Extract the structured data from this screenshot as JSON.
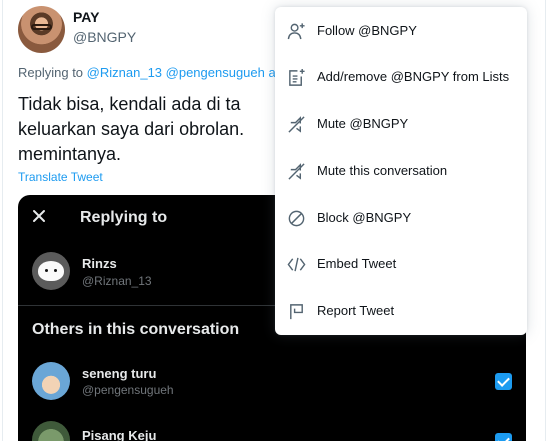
{
  "tweet": {
    "author_name": "PAY",
    "author_handle": "@BNGPY",
    "replying_prefix": "Replying to",
    "replying_mentions": "@Riznan_13 @pengensugueh ar",
    "text_line1": "Tidak bisa, kendali ada di ta",
    "text_line2": "keluarkan saya dari obrolan.",
    "text_line3": "memintanya.",
    "translate_link": "Translate Tweet"
  },
  "embedded_image": {
    "title": "Replying to",
    "primary_user": {
      "name": "Rinzs",
      "handle": "@Riznan_13"
    },
    "section_title": "Others in this conversation",
    "users": [
      {
        "name": "seneng turu",
        "handle": "@pengensugueh",
        "checked": true
      },
      {
        "name": "Pisang Keju",
        "handle": "",
        "checked": true
      }
    ]
  },
  "menu": {
    "items": [
      {
        "label": "Follow @BNGPY",
        "icon": "follow-icon"
      },
      {
        "label": "Add/remove @BNGPY from Lists",
        "icon": "list-add-icon"
      },
      {
        "label": "Mute @BNGPY",
        "icon": "mute-icon"
      },
      {
        "label": "Mute this conversation",
        "icon": "mute-conversation-icon"
      },
      {
        "label": "Block @BNGPY",
        "icon": "block-icon"
      },
      {
        "label": "Embed Tweet",
        "icon": "embed-icon"
      },
      {
        "label": "Report Tweet",
        "icon": "report-flag-icon"
      }
    ]
  },
  "colors": {
    "accent": "#1d9bf0",
    "text_primary": "#0f1419",
    "text_secondary": "#536471",
    "embed_background": "#000000"
  }
}
